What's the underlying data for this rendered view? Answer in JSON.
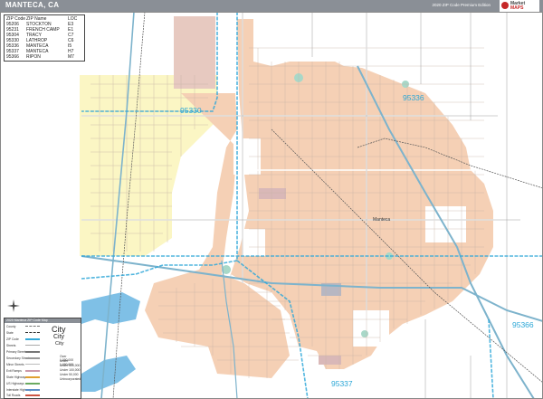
{
  "header": {
    "title": "MANTECA, CA",
    "edition": "2020 ZIP Code Premium Edition",
    "logo_line1": "Market",
    "logo_line2": "MAPS"
  },
  "colors": {
    "title_bar": "#8a8f96",
    "city_fill": "#f5d0b5",
    "unincorporated_fill": "#fbf6c4",
    "water": "#7fc0e6",
    "zip_label": "#2aa6d6",
    "zip_boundary": "#33a9d9",
    "highway": "#7db3cc",
    "railroad": "#555555"
  },
  "zip_table": {
    "headers": [
      "ZIP Code",
      "ZIP Name",
      "LOC"
    ],
    "rows": [
      [
        "95206",
        "STOCKTON",
        "E3"
      ],
      [
        "95231",
        "FRENCH CAMP",
        "E1"
      ],
      [
        "95304",
        "TRACY",
        "C7"
      ],
      [
        "95330",
        "LATHROP",
        "C6"
      ],
      [
        "95336",
        "MANTECA",
        "I5"
      ],
      [
        "95337",
        "MANTECA",
        "H7"
      ],
      [
        "95366",
        "RIPON",
        "M7"
      ]
    ]
  },
  "zip_labels": [
    "95330",
    "95336",
    "95366",
    "95337"
  ],
  "places": {
    "manteca": "Manteca"
  },
  "legend": {
    "header": "2020 Manteca ZIP Code Map",
    "rows": [
      "County",
      "State",
      "ZIP Code",
      "Streets",
      "Primary Streets",
      "Secondary Streets",
      "Minor Streets",
      "Exit Ramps",
      "State Highways",
      "US Highways",
      "Interstate Highways",
      "Toll Roads"
    ],
    "city_samples": [
      "City",
      "City",
      "City"
    ],
    "pop_labels": [
      "Over 1,000,000",
      "Under 1,000,000",
      "Under 500,000",
      "Under 100,000",
      "Under 50,000",
      "Unincorporated"
    ]
  }
}
